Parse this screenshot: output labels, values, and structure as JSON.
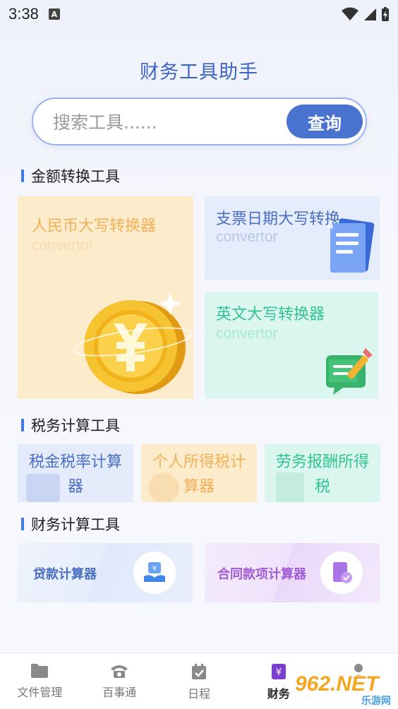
{
  "status_bar": {
    "time": "3:38",
    "notification_badge": "A"
  },
  "app": {
    "title": "财务工具助手"
  },
  "search": {
    "placeholder": "搜索工具......",
    "button_label": "查询"
  },
  "sections": {
    "amount_tools": {
      "title": "金额转换工具",
      "cards": [
        {
          "title": "人民币大写转换器",
          "sub": "convertor",
          "icon": "yuan-coin-icon"
        },
        {
          "title": "支票日期大写转换",
          "sub": "convertor",
          "icon": "document-icon"
        },
        {
          "title": "英文大写转换器",
          "sub": "convertor",
          "icon": "chat-edit-icon"
        }
      ]
    },
    "tax_tools": {
      "title": "税务计算工具",
      "cards": [
        {
          "label": "税金税率计算器"
        },
        {
          "label": "个人所得税计算器"
        },
        {
          "label": "劳务报酬所得税"
        }
      ]
    },
    "finance_tools": {
      "title": "财务计算工具",
      "cards": [
        {
          "label": "贷款计算器",
          "icon": "yuan-hand-icon"
        },
        {
          "label": "合同款项计算器",
          "icon": "contract-check-icon"
        }
      ]
    }
  },
  "bottom_nav": [
    {
      "label": "文件管理",
      "icon": "folder-icon",
      "active": false
    },
    {
      "label": "百事通",
      "icon": "phone-icon",
      "active": false
    },
    {
      "label": "日程",
      "icon": "calendar-check-icon",
      "active": false
    },
    {
      "label": "财务",
      "icon": "yuan-icon",
      "active": true
    },
    {
      "label": "",
      "icon": "user-icon",
      "active": false
    }
  ],
  "watermark": {
    "text": "962.NET",
    "sub": "乐游网"
  },
  "colors": {
    "accent": "#4a72cf",
    "title_blue": "#3d63c4",
    "orange": "#f3b05a",
    "green": "#33c391",
    "purple": "#a15bd6"
  }
}
